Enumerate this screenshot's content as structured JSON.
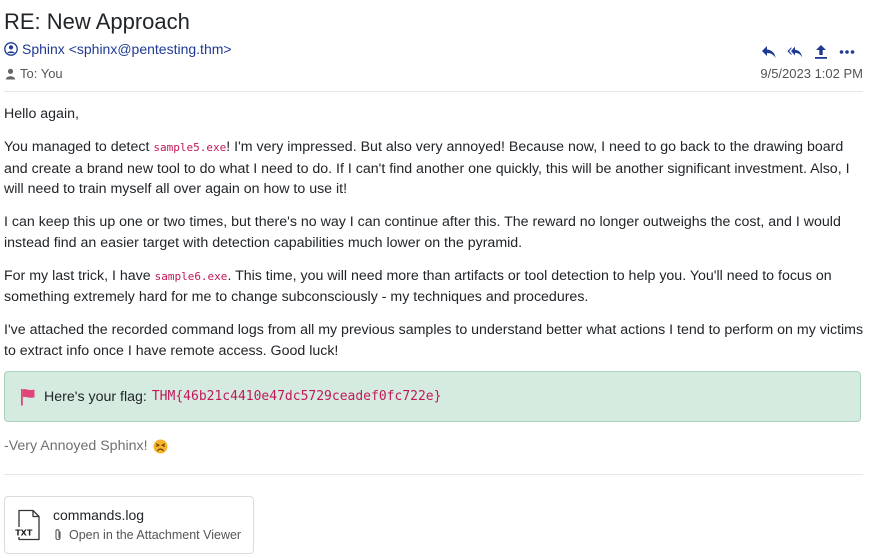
{
  "email": {
    "subject": "RE: New Approach",
    "sender": "Sphinx <sphinx@pentesting.thm>",
    "to_label": "To: You",
    "date": "9/5/2023 1:02 PM",
    "actions": [
      {
        "name": "reply-icon"
      },
      {
        "name": "reply-all-icon"
      },
      {
        "name": "forward-icon"
      },
      {
        "name": "more-icon"
      }
    ]
  },
  "body": {
    "greeting": "Hello again,",
    "p1_before": "You managed to detect ",
    "p1_code": "sample5.exe",
    "p1_after": "! I'm very impressed. But also very annoyed! Because now, I need to go back to the drawing board and create a brand new tool to do what I need to do. If I can't find another one quickly, this will be another significant investment. Also, I will need to train myself all over again on how to use it!",
    "p2": "I can keep this up one or two times, but there's no way I can continue after this. The reward no longer outweighs the cost, and I would instead find an easier target with detection capabilities much lower on the pyramid.",
    "p3_before": "For my last trick, I have ",
    "p3_code": "sample6.exe",
    "p3_after": ". This time, you will need more than artifacts or tool detection to help you. You'll need to focus on something extremely hard for me to change subconsciously - my techniques and procedures.",
    "p4": "I've attached the recorded command logs from all my previous samples to understand better what actions I tend to perform on my victims to extract info once I have remote access. Good luck!"
  },
  "flag": {
    "label": "Here's your flag:",
    "value": "THM{46b21c4410e47dc5729ceadef0fc722e}",
    "icon": "flag-icon",
    "color": "#d6ebe0"
  },
  "signature": {
    "text": "-Very Annoyed Sphinx!",
    "emoji": "angry-face-emoji"
  },
  "attachment": {
    "file_name": "commands.log",
    "open_label": "Open in the Attachment Viewer",
    "icon_label": "TXT"
  },
  "colors": {
    "sender": "#1f3a93",
    "code": "#c2185b",
    "flag_bg": "#d6ebe0",
    "flag_border": "#a9d4bb"
  }
}
